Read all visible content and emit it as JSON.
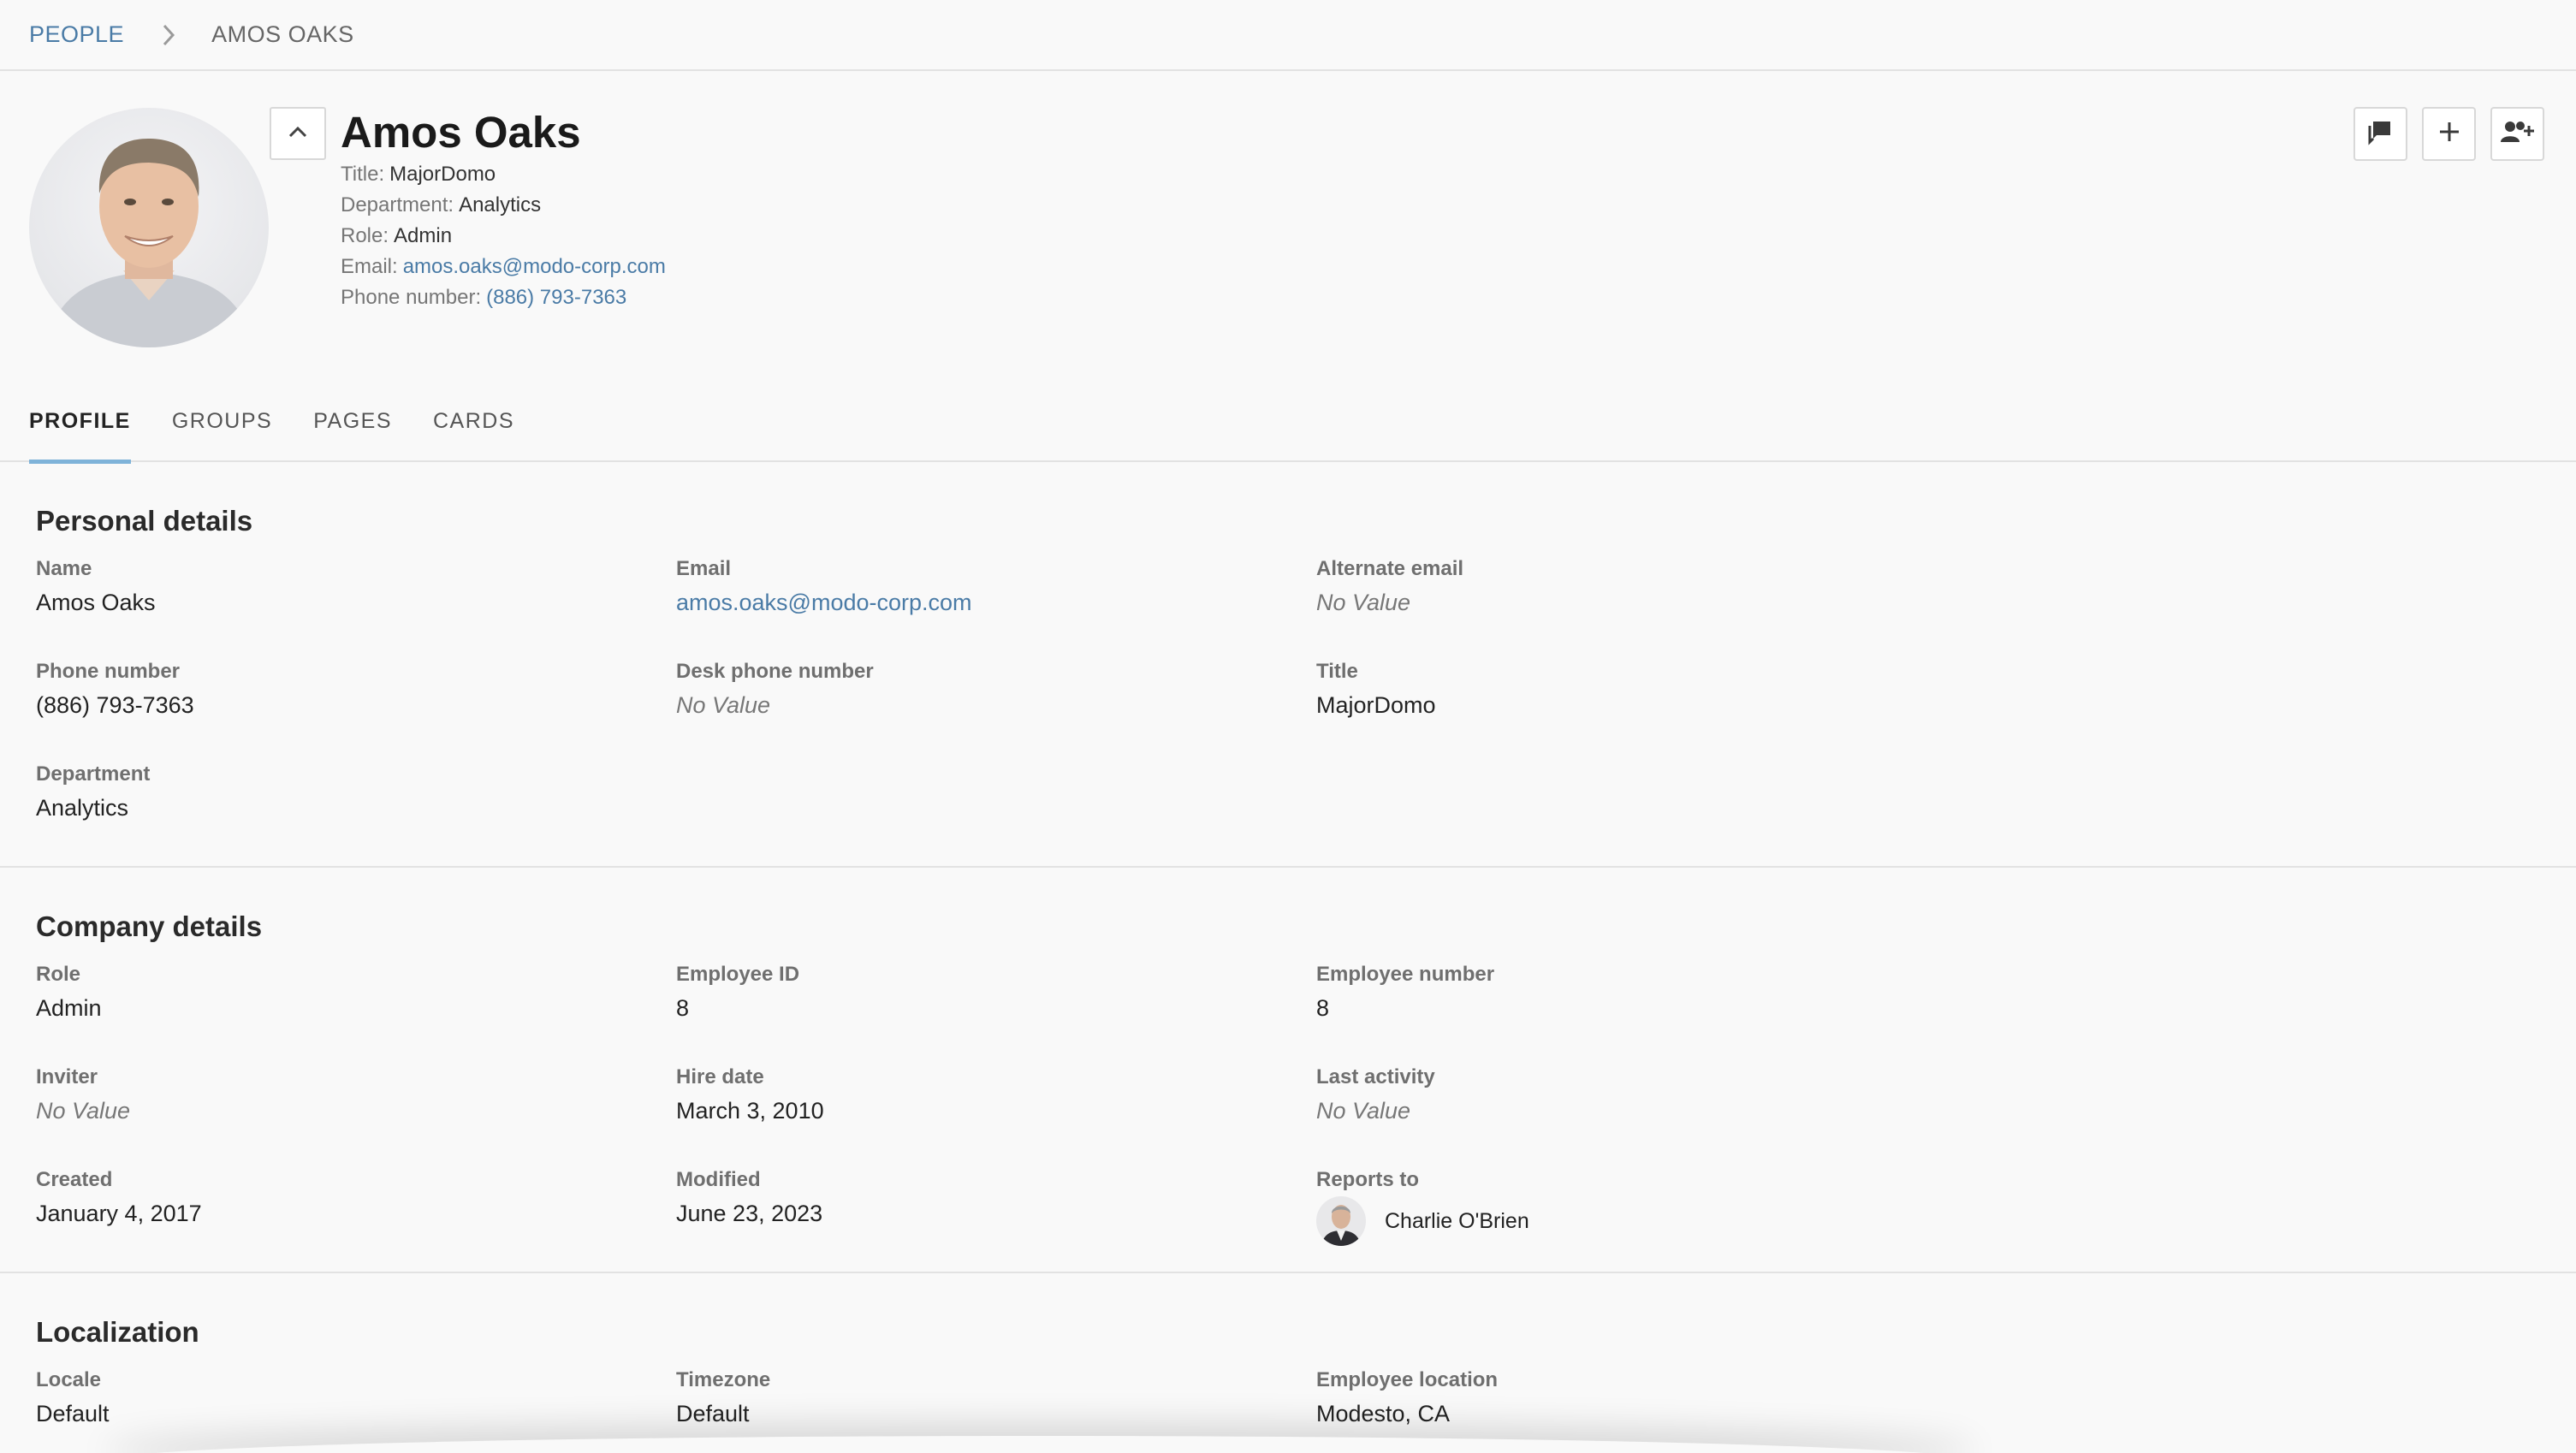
{
  "breadcrumb": {
    "root": "PEOPLE",
    "current": "AMOS OAKS"
  },
  "header": {
    "name": "Amos Oaks",
    "title_label": "Title:",
    "title_value": "MajorDomo",
    "department_label": "Department:",
    "department_value": "Analytics",
    "role_label": "Role:",
    "role_value": "Admin",
    "email_label": "Email:",
    "email_value": "amos.oaks@modo-corp.com",
    "phone_label": "Phone number:",
    "phone_value": "(886) 793-7363"
  },
  "actions": {
    "icons": [
      "chat-icon",
      "plus-icon",
      "add-user-icon"
    ]
  },
  "tabs": [
    {
      "label": "PROFILE",
      "active": true
    },
    {
      "label": "GROUPS",
      "active": false
    },
    {
      "label": "PAGES",
      "active": false
    },
    {
      "label": "CARDS",
      "active": false
    }
  ],
  "personal": {
    "title": "Personal details",
    "name_label": "Name",
    "name_value": "Amos Oaks",
    "email_label": "Email",
    "email_value": "amos.oaks@modo-corp.com",
    "alt_email_label": "Alternate email",
    "alt_email_value": "No Value",
    "phone_label": "Phone number",
    "phone_value": "(886) 793-7363",
    "desk_phone_label": "Desk phone number",
    "desk_phone_value": "No Value",
    "title_label": "Title",
    "title_value": "MajorDomo",
    "department_label": "Department",
    "department_value": "Analytics"
  },
  "company": {
    "title": "Company details",
    "role_label": "Role",
    "role_value": "Admin",
    "employee_id_label": "Employee ID",
    "employee_id_value": "8",
    "employee_number_label": "Employee number",
    "employee_number_value": "8",
    "inviter_label": "Inviter",
    "inviter_value": "No Value",
    "hire_date_label": "Hire date",
    "hire_date_value": "March 3, 2010",
    "last_activity_label": "Last activity",
    "last_activity_value": "No Value",
    "created_label": "Created",
    "created_value": "January 4, 2017",
    "modified_label": "Modified",
    "modified_value": "June 23, 2023",
    "reports_to_label": "Reports to",
    "reports_to_value": "Charlie O'Brien"
  },
  "localization": {
    "title": "Localization",
    "locale_label": "Locale",
    "locale_value": "Default",
    "timezone_label": "Timezone",
    "timezone_value": "Default",
    "location_label": "Employee location",
    "location_value": "Modesto, CA"
  },
  "colors": {
    "link": "#4a7ba6",
    "tab_indicator": "#7fb3d9",
    "border": "#e2e2e2"
  }
}
